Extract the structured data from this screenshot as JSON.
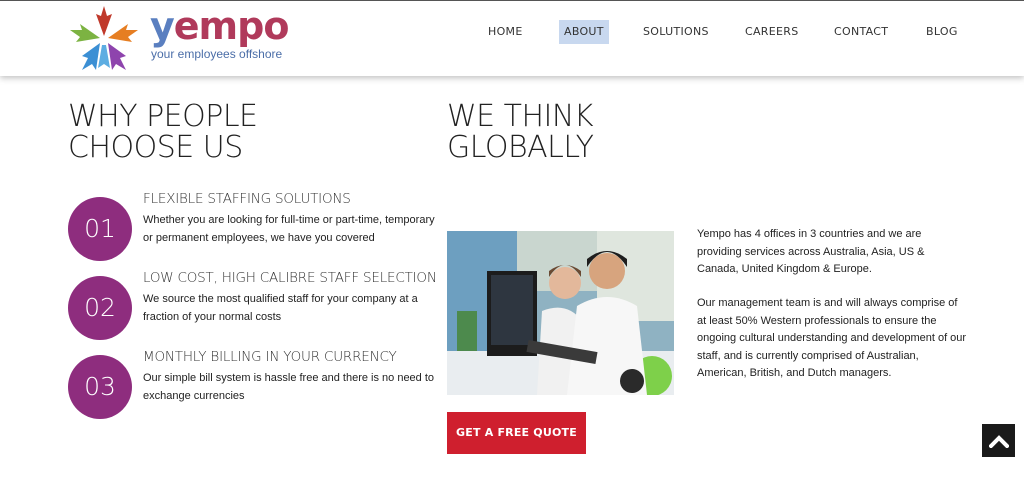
{
  "logo": {
    "word_y": "y",
    "word_rest": "empo",
    "tagline": "your employees offshore"
  },
  "nav": {
    "items": [
      {
        "label": "HOME"
      },
      {
        "label": "ABOUT",
        "active": true
      },
      {
        "label": "SOLUTIONS"
      },
      {
        "label": "CAREERS"
      },
      {
        "label": "CONTACT"
      },
      {
        "label": "BLOG"
      }
    ]
  },
  "why": {
    "heading_line1": "WHY PEOPLE",
    "heading_line2": "CHOOSE US",
    "features": [
      {
        "number": "01",
        "title": "FLEXIBLE STAFFING SOLUTIONS",
        "desc": "Whether you are looking for full-time or part-time, temporary or permanent employees, we have you covered"
      },
      {
        "number": "02",
        "title": "LOW COST, HIGH CALIBRE STAFF SELECTION",
        "desc": "We source the most qualified staff for your company at a fraction of your normal costs"
      },
      {
        "number": "03",
        "title": "MONTHLY BILLING IN YOUR CURRENCY",
        "desc": "Our simple bill system is hassle free and there is no need to exchange currencies"
      }
    ]
  },
  "globally": {
    "heading_line1": "WE THINK",
    "heading_line2": "GLOBALLY",
    "paragraph1": "Yempo has 4 offices in 3 countries and we are providing services across Australia, Asia, US & Canada, United Kingdom & Europe.",
    "paragraph2": "Our management team is and will always comprise of at least 50% Western professionals to ensure the ongoing cultural understanding and development of our staff, and is currently comprised of Australian, American, British, and Dutch managers.",
    "cta": "GET A FREE QUOTE"
  },
  "colors": {
    "accent_purple": "#8e2d7e",
    "cta_red": "#cf1f2e",
    "nav_active_bg": "#c8d8ef"
  },
  "icons": {
    "logo_mark": "flower-logo-icon",
    "back_to_top": "chevron-up-icon"
  }
}
